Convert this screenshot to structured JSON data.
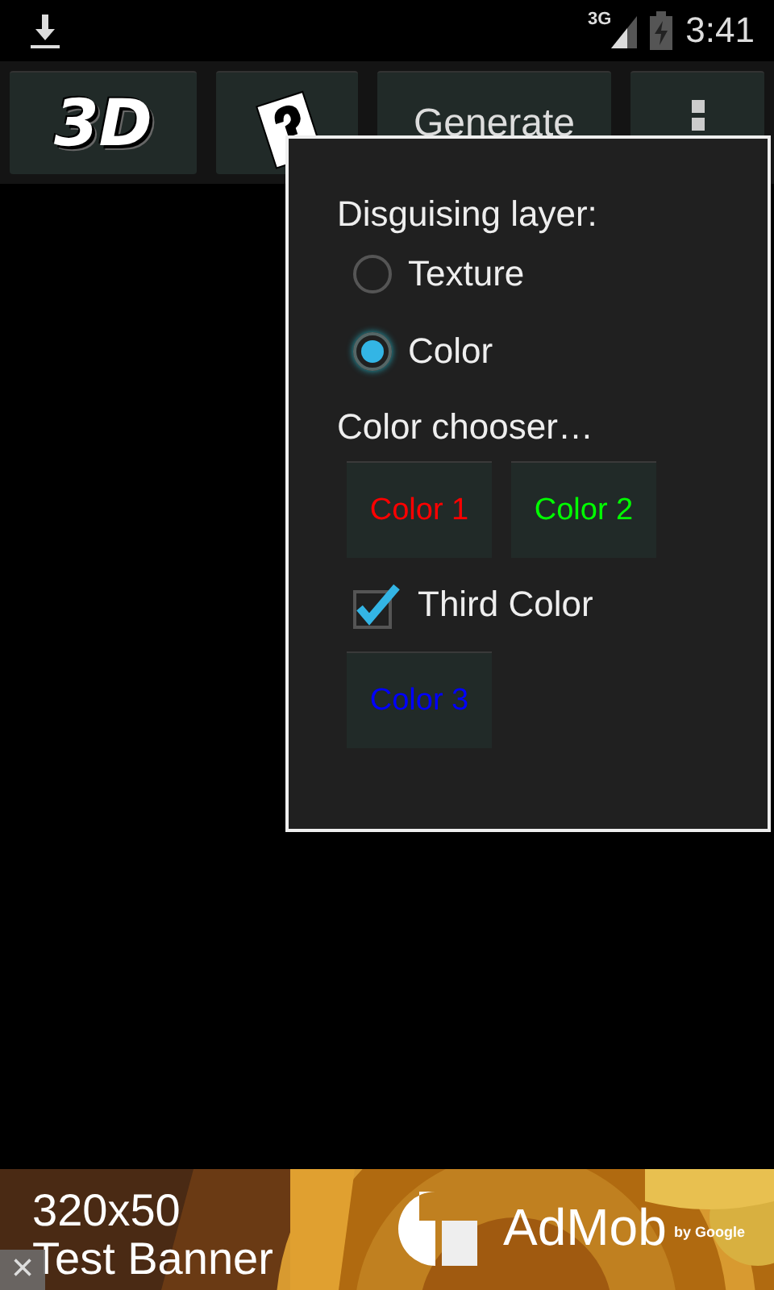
{
  "status_bar": {
    "network": "3G",
    "time": "3:41"
  },
  "toolbar": [
    {
      "kind": "logo",
      "label": "3D"
    },
    {
      "kind": "mystery"
    },
    {
      "kind": "text",
      "label": "Generate"
    },
    {
      "kind": "overflow"
    }
  ],
  "popup": {
    "title": "Disguising layer:",
    "radios": [
      {
        "label": "Texture",
        "selected": false
      },
      {
        "label": "Color",
        "selected": true
      }
    ],
    "section": "Color chooser…",
    "color_buttons": [
      {
        "label": "Color 1",
        "color": "#ff0000"
      },
      {
        "label": "Color 2",
        "color": "#00ff00"
      }
    ],
    "checkbox": {
      "label": "Third Color",
      "checked": true
    },
    "extra_button": {
      "label": "Color 3",
      "color": "#0000ff"
    }
  },
  "banner": {
    "kind": "picture",
    "line_1": "320x50",
    "line_2": "Test Banner",
    "brand": "AdMob",
    "byline": "by Google",
    "close": "×"
  }
}
